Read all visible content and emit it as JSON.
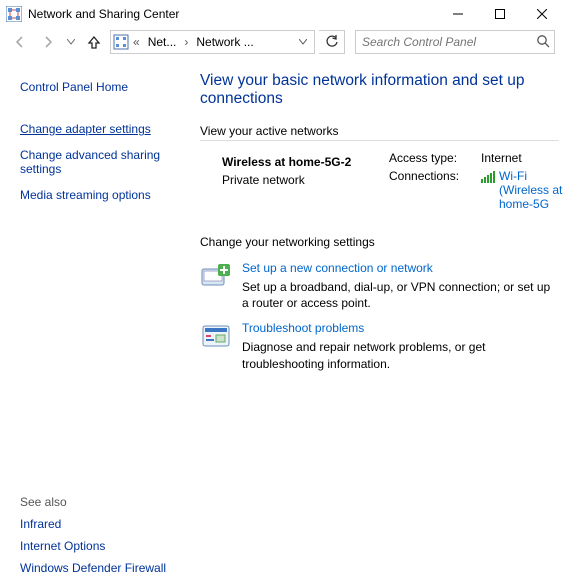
{
  "titlebar": {
    "title": "Network and Sharing Center"
  },
  "nav": {
    "breadcrumb": {
      "seg1": "Net...",
      "seg2": "Network ..."
    },
    "search_placeholder": "Search Control Panel"
  },
  "sidebar": {
    "home": "Control Panel Home",
    "links": [
      {
        "label": "Change adapter settings",
        "active": true
      },
      {
        "label": "Change advanced sharing settings",
        "active": false
      },
      {
        "label": "Media streaming options",
        "active": false
      }
    ],
    "see_also_label": "See also",
    "see_also": [
      "Infrared",
      "Internet Options",
      "Windows Defender Firewall"
    ]
  },
  "content": {
    "title": "View your basic network information and set up connections",
    "active_networks_label": "View your active networks",
    "network": {
      "name": "Wireless at home-5G-2",
      "type": "Private network",
      "access_label": "Access type:",
      "access_value": "Internet",
      "connections_label": "Connections:",
      "connection_name": "Wi-Fi (Wireless at home-5G"
    },
    "change_settings_label": "Change your networking settings",
    "items": [
      {
        "title": "Set up a new connection or network",
        "desc": "Set up a broadband, dial-up, or VPN connection; or set up a router or access point."
      },
      {
        "title": "Troubleshoot problems",
        "desc": "Diagnose and repair network problems, or get troubleshooting information."
      }
    ]
  }
}
